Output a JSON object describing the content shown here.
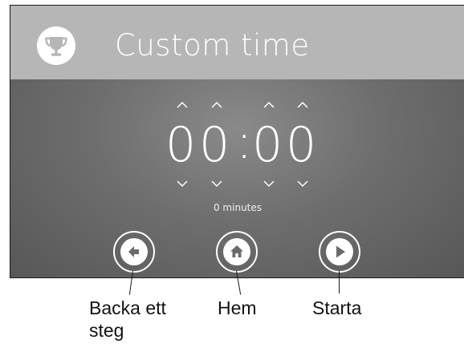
{
  "header": {
    "title": "Custom time",
    "icon": "trophy-icon",
    "background": "#b6b6b6"
  },
  "timer": {
    "hours_tens": "0",
    "hours_ones": "0",
    "separator": ":",
    "minutes_tens": "0",
    "minutes_ones": "0",
    "minutes_label": "0 minutes"
  },
  "controls": {
    "back_icon": "arrow-left-icon",
    "home_icon": "home-icon",
    "start_icon": "play-icon"
  },
  "captions": {
    "back_line1": "Backa ett",
    "back_line2": "steg",
    "home": "Hem",
    "start": "Starta"
  }
}
